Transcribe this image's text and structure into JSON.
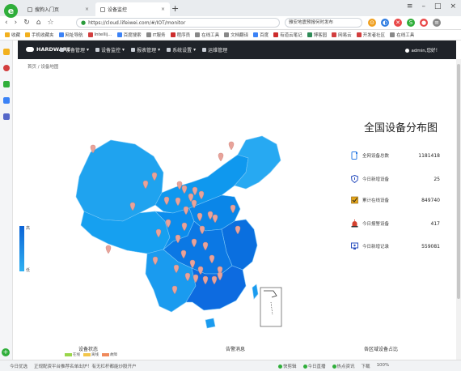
{
  "browser": {
    "tabs": [
      {
        "label": "搜狗入门页"
      },
      {
        "label": "设备监控"
      }
    ],
    "url": "https://cloud.lifeiwei.com/#/IOT/monitor",
    "search_text": "雅安地震预报何时发布",
    "bookmarks": [
      {
        "label": "收藏",
        "color": "#f2b01e"
      },
      {
        "label": "手机收藏夹",
        "color": "#f2b01e"
      },
      {
        "label": "网址导航",
        "color": "#3b82f6"
      },
      {
        "label": "Intellij...",
        "color": "#d23e3e"
      },
      {
        "label": "百度搜索",
        "color": "#3b82f6"
      },
      {
        "label": "IT服务",
        "color": "#888888"
      },
      {
        "label": "程序员",
        "color": "#cc2b2b"
      },
      {
        "label": "在线工具",
        "color": "#888888"
      },
      {
        "label": "文档翻译",
        "color": "#888888"
      },
      {
        "label": "百度",
        "color": "#3b82f6"
      },
      {
        "label": "有道云笔记",
        "color": "#cc2b2b"
      },
      {
        "label": "博客园",
        "color": "#2e8b57"
      },
      {
        "label": "网易云",
        "color": "#d23e3e"
      },
      {
        "label": "开发者社区",
        "color": "#d23e3e"
      },
      {
        "label": "在线工具",
        "color": "#888888"
      }
    ]
  },
  "app": {
    "brand": "HARDWARE",
    "menu": [
      {
        "label": "设备管理"
      },
      {
        "label": "设备监控"
      },
      {
        "label": "报表管理"
      },
      {
        "label": "系统设置"
      },
      {
        "label": "运维管理"
      }
    ],
    "user": "admin,您好！",
    "breadcrumb": "首页 / 设备地图"
  },
  "map": {
    "legend_high": "高",
    "legend_low": "低"
  },
  "panel": {
    "title": "全国设备分布图",
    "stats": [
      {
        "label": "全网设备总数",
        "value": "1181418",
        "icon": "device-icon",
        "color": "#2a7be4"
      },
      {
        "label": "今日新增设备",
        "value": "25",
        "icon": "shield-icon",
        "color": "#2a4fbf"
      },
      {
        "label": "累计在线设备",
        "value": "849740",
        "icon": "checkbox-icon",
        "color": "#e4a61b"
      },
      {
        "label": "今日报警设备",
        "value": "417",
        "icon": "alarm-icon",
        "color": "#d4412f"
      },
      {
        "label": "今日新增记录",
        "value": "559081",
        "icon": "monitor-icon",
        "color": "#2a4fbf"
      }
    ]
  },
  "bottom": {
    "tabs": [
      {
        "label": "设备状态"
      },
      {
        "label": "告警消息"
      },
      {
        "label": "各区域设备占比"
      }
    ],
    "legend": [
      {
        "label": "在线",
        "color": "#9ad64b"
      },
      {
        "label": "离线",
        "color": "#f3c64a"
      },
      {
        "label": "故障",
        "color": "#ef8a5c"
      }
    ]
  },
  "statusbar": {
    "left": [
      "今日优选",
      "正规配资平台推荐名单出炉！有无杠杆都能炒股开户"
    ],
    "right": [
      "快剪辑",
      "今日直播",
      "热点资讯",
      "下载",
      "100%"
    ]
  }
}
